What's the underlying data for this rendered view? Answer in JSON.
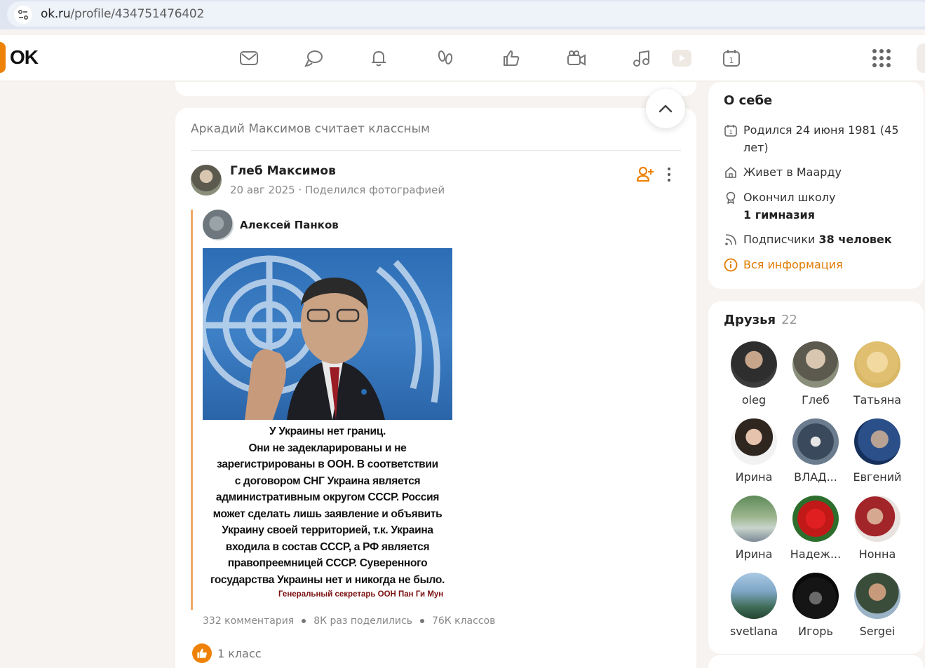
{
  "browser": {
    "url_host": "ok.ru",
    "url_path": "/profile/434751476402"
  },
  "nav": {
    "logo": "OK",
    "icons": [
      "mail-icon",
      "chat-icon",
      "bell-icon",
      "guests-icon",
      "like-icon",
      "video-icon",
      "music-icon",
      "video-play-icon",
      "calendar-icon",
      "apps-icon"
    ]
  },
  "feed": {
    "header": "Аркадий Максимов считает классным",
    "post": {
      "author": "Глеб Максимов",
      "date": "20 авг 2025",
      "action": "Поделился фотографией",
      "repost_author": "Алексей Панков",
      "quote_lines": [
        "У Украины нет границ.",
        "Они не задекларированы и не",
        "зарегистрированы в ООН. В соответствии",
        "с договором СНГ Украина является",
        "административным округом СССР. Россия",
        "может сделать лишь заявление и объявить",
        "Украину своей территорией, т.к. Украина",
        "входила в состав СССР, а РФ является",
        "правопреемницей СССР. Суверенного",
        "государства Украины нет и никогда не было."
      ],
      "quote_signature": "Генеральный секретарь ООН Пан Ги Мун",
      "comments": "332 комментария",
      "shares": "8К раз поделились",
      "classes": "76К классов",
      "likes": "1 класс"
    }
  },
  "about": {
    "title": "О себе",
    "born": "Родился 24 июня 1981 (45 лет)",
    "lives": "Живет в Маарду",
    "school_label": "Окончил школу",
    "school_name": "1 гимназия",
    "followers_label": "Подписчики",
    "followers_count": "38 человек",
    "all_info": "Вся информация",
    "accent_color": "#e07a00"
  },
  "friends": {
    "title": "Друзья",
    "count": "22",
    "items": [
      {
        "name": "oleg"
      },
      {
        "name": "Глеб"
      },
      {
        "name": "Татьяна"
      },
      {
        "name": "Ирина"
      },
      {
        "name": "ВЛАД..."
      },
      {
        "name": "Евгений"
      },
      {
        "name": "Ирина"
      },
      {
        "name": "Надеж..."
      },
      {
        "name": "Нонна"
      },
      {
        "name": "svetlana"
      },
      {
        "name": "Игорь"
      },
      {
        "name": "Sergei"
      }
    ]
  }
}
